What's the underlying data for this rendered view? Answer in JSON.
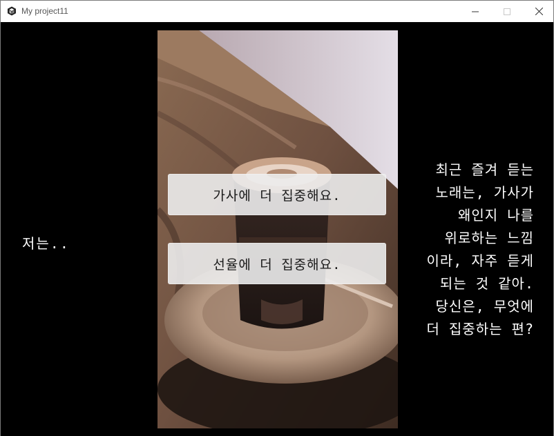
{
  "window": {
    "title": "My project11",
    "icon": "unity-cube-icon",
    "controls": [
      "minimize-icon",
      "maximize-icon",
      "close-icon"
    ]
  },
  "scene": {
    "image": "pixelated coffee cup on saucer"
  },
  "speaker": {
    "text": "저는.."
  },
  "choices": [
    {
      "label": "가사에 더 집중해요."
    },
    {
      "label": "선율에 더 집중해요."
    }
  ],
  "dialogue": {
    "lines": [
      "최근 즐겨 듣는",
      "노래는, 가사가",
      "왜인지 나를",
      "위로하는 느낌",
      "이라, 자주 듣게",
      "되는 것 같아.",
      "당신은, 무엇에",
      "더 집중하는 편?"
    ]
  },
  "colors": {
    "background": "#000000",
    "text": "#ffffff",
    "choice_bg": "#ececec",
    "choice_text": "#1a1a1a"
  }
}
